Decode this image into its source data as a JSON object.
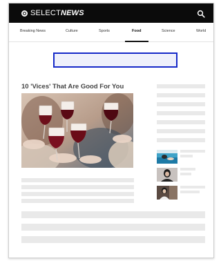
{
  "header": {
    "logo_prefix": "SELECT",
    "logo_suffix": "NEWS",
    "search_icon": "search-icon"
  },
  "nav": {
    "items": [
      {
        "label": "Breaking News"
      },
      {
        "label": "Culture"
      },
      {
        "label": "Sports"
      },
      {
        "label": "Food",
        "active": true
      },
      {
        "label": "Science"
      },
      {
        "label": "World"
      }
    ]
  },
  "article": {
    "headline": "10 'Vices' That Are Good For You",
    "hero_image": "friends-toasting-red-wine-glasses"
  },
  "sidebar": {
    "thumbnails": [
      "swimming-pool-photo",
      "portrait-photo",
      "fashion-photo"
    ]
  },
  "colors": {
    "header_bg": "#0b0b0b",
    "ad_border": "#1428c8",
    "ad_fill": "#eef0fb",
    "placeholder": "#e9e9e9"
  }
}
